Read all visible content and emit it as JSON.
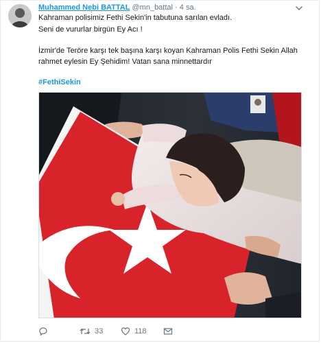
{
  "tweet": {
    "author_name": "Muhammed Nebi BATTAL",
    "handle": "@mn_battal",
    "separator": "·",
    "time": "4 sa.",
    "lines": [
      "Kahraman polisimiz Fethi Sekin'in tabutuna sarılan evladı.",
      "Seni de vururlar birgün Ey Acı !",
      "İzmir'de Teröre karşı tek başına karşı koyan Kahraman Polis Fethi Sekin Allah",
      "rahmet eylesin Ey Şehidim! Vatan sana minnettardır"
    ],
    "hashtag": "#FethiSekin"
  },
  "actions": {
    "reply_count": "",
    "retweet_count": "33",
    "like_count": "118"
  },
  "icons": {
    "reply": "reply-icon",
    "retweet": "retweet-icon",
    "like": "heart-icon",
    "dm": "envelope-icon",
    "menu": "chevron-down-icon"
  },
  "colors": {
    "link": "#1b95e0",
    "text": "#14171a",
    "muted": "#657786",
    "flag_red": "#d8232a"
  }
}
